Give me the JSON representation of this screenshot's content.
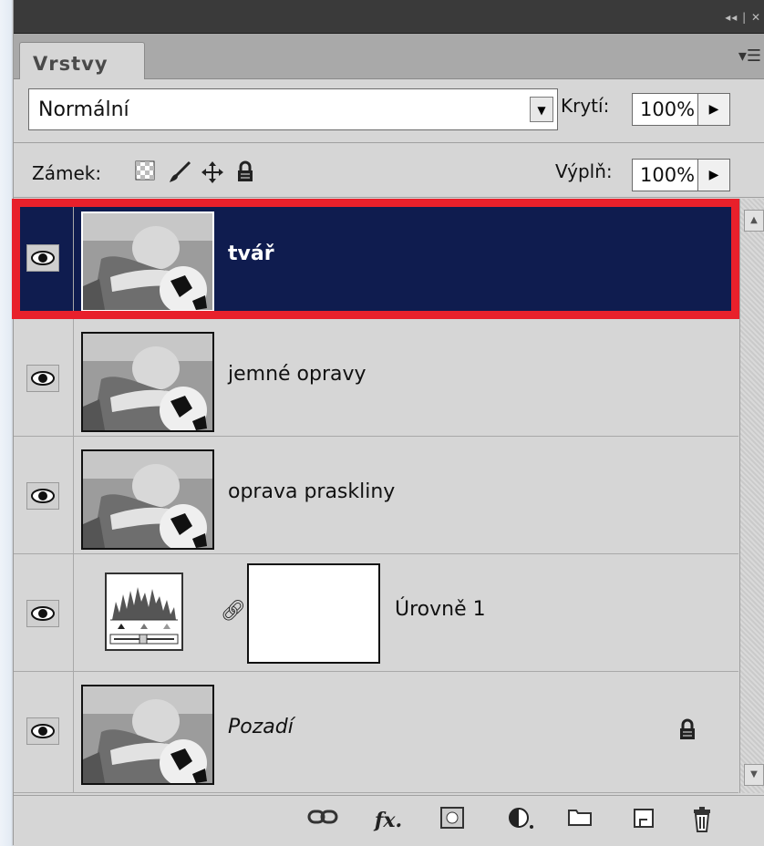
{
  "panel": {
    "tab_label": "Vrstvy",
    "blend_mode": "Normální",
    "opacity_label": "Krytí:",
    "opacity_value": "100%",
    "lock_label": "Zámek:",
    "fill_label": "Výplň:",
    "fill_value": "100%"
  },
  "layers": [
    {
      "name": "tvář",
      "selected": true,
      "visible": true
    },
    {
      "name": "jemné opravy",
      "selected": false,
      "visible": true
    },
    {
      "name": "oprava praskliny",
      "selected": false,
      "visible": true
    },
    {
      "name": "Úrovně 1",
      "selected": false,
      "visible": true,
      "type": "levels-adjustment"
    },
    {
      "name": "Pozadí",
      "selected": false,
      "visible": true,
      "locked": true,
      "italic": true
    }
  ],
  "icons": {
    "lock_buttons": [
      "lock-transparency-icon",
      "lock-paint-icon",
      "lock-move-icon",
      "lock-all-icon"
    ],
    "bottom_buttons": [
      "link-layers-icon",
      "fx-icon",
      "add-mask-icon",
      "adjustment-layer-icon",
      "new-group-icon",
      "new-layer-icon",
      "delete-layer-icon"
    ]
  },
  "colors": {
    "selected_row": "#0f1c4f",
    "highlight_border": "#e8202b"
  }
}
